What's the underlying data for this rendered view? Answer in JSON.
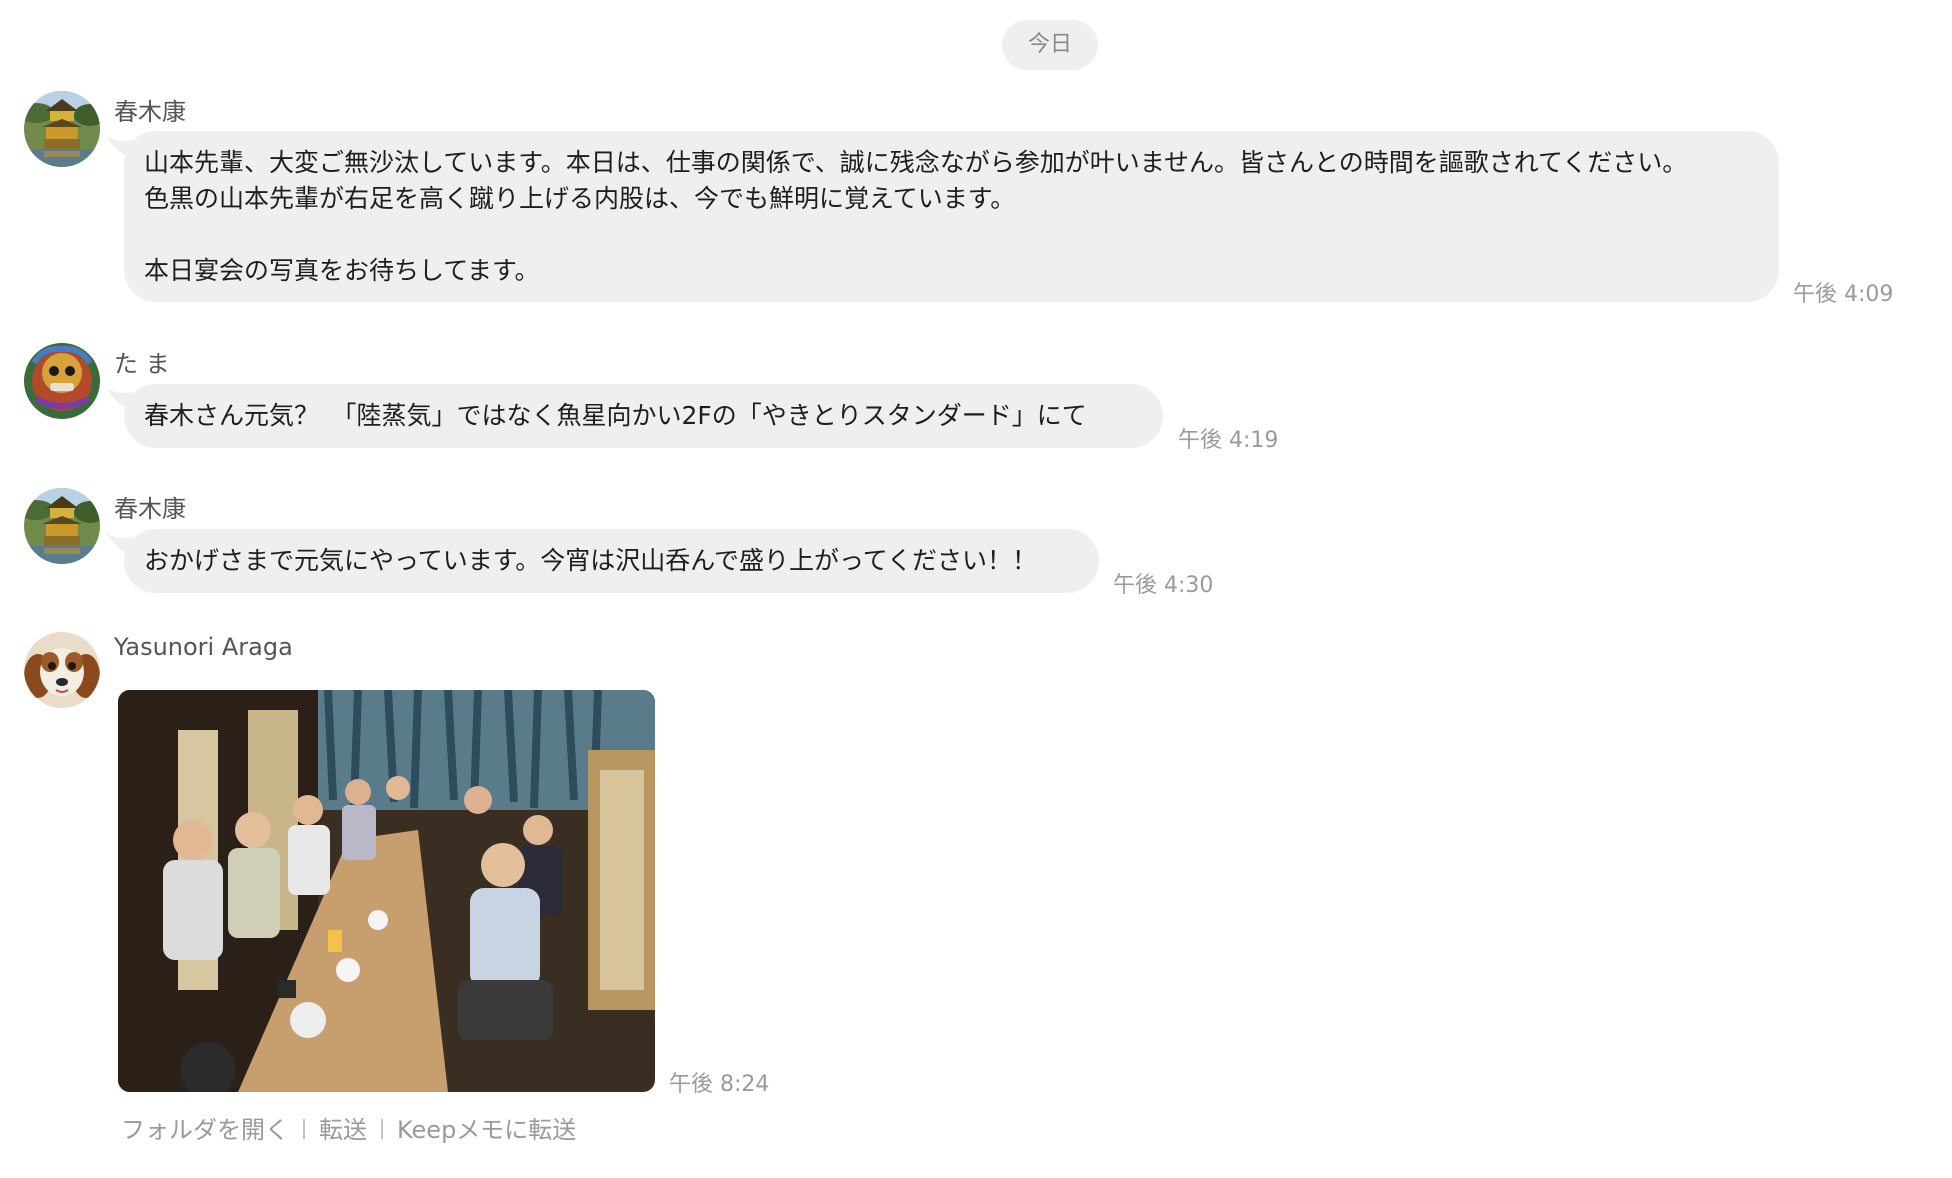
{
  "date_separator": "今日",
  "messages": [
    {
      "sender": "春木康",
      "avatar": "golden-pavilion-avatar",
      "lines": [
        "山本先輩、大変ご無沙汰しています。本日は、仕事の関係で、誠に残念ながら参加が叶いません。皆さんとの時間を謳歌されてください。",
        "色黒の山本先輩が右足を高く蹴り上げる内股は、今でも鮮明に覚えています。",
        "",
        "本日宴会の写真をお待ちしてます。"
      ],
      "time": "午後 4:09"
    },
    {
      "sender": "た ま",
      "avatar": "lion-dance-avatar",
      "lines": [
        "春木さん元気？　「陸蒸気」ではなく魚星向かい2Fの「やきとりスタンダード」にて"
      ],
      "time": "午後 4:19"
    },
    {
      "sender": "春木康",
      "avatar": "golden-pavilion-avatar",
      "lines": [
        "おかげさまで元気にやっています。今宵は沢山呑んで盛り上がってください！！"
      ],
      "time": "午後 4:30"
    },
    {
      "sender": "Yasunori Araga",
      "avatar": "dog-avatar",
      "image": "group-dinner-photo",
      "time": "午後 8:24",
      "actions": [
        "フォルダを開く",
        "転送",
        "Keepメモに転送"
      ]
    }
  ],
  "colors": {
    "bubble": "#efefef",
    "timestamp": "#9a9a9a",
    "sender": "#555555"
  }
}
